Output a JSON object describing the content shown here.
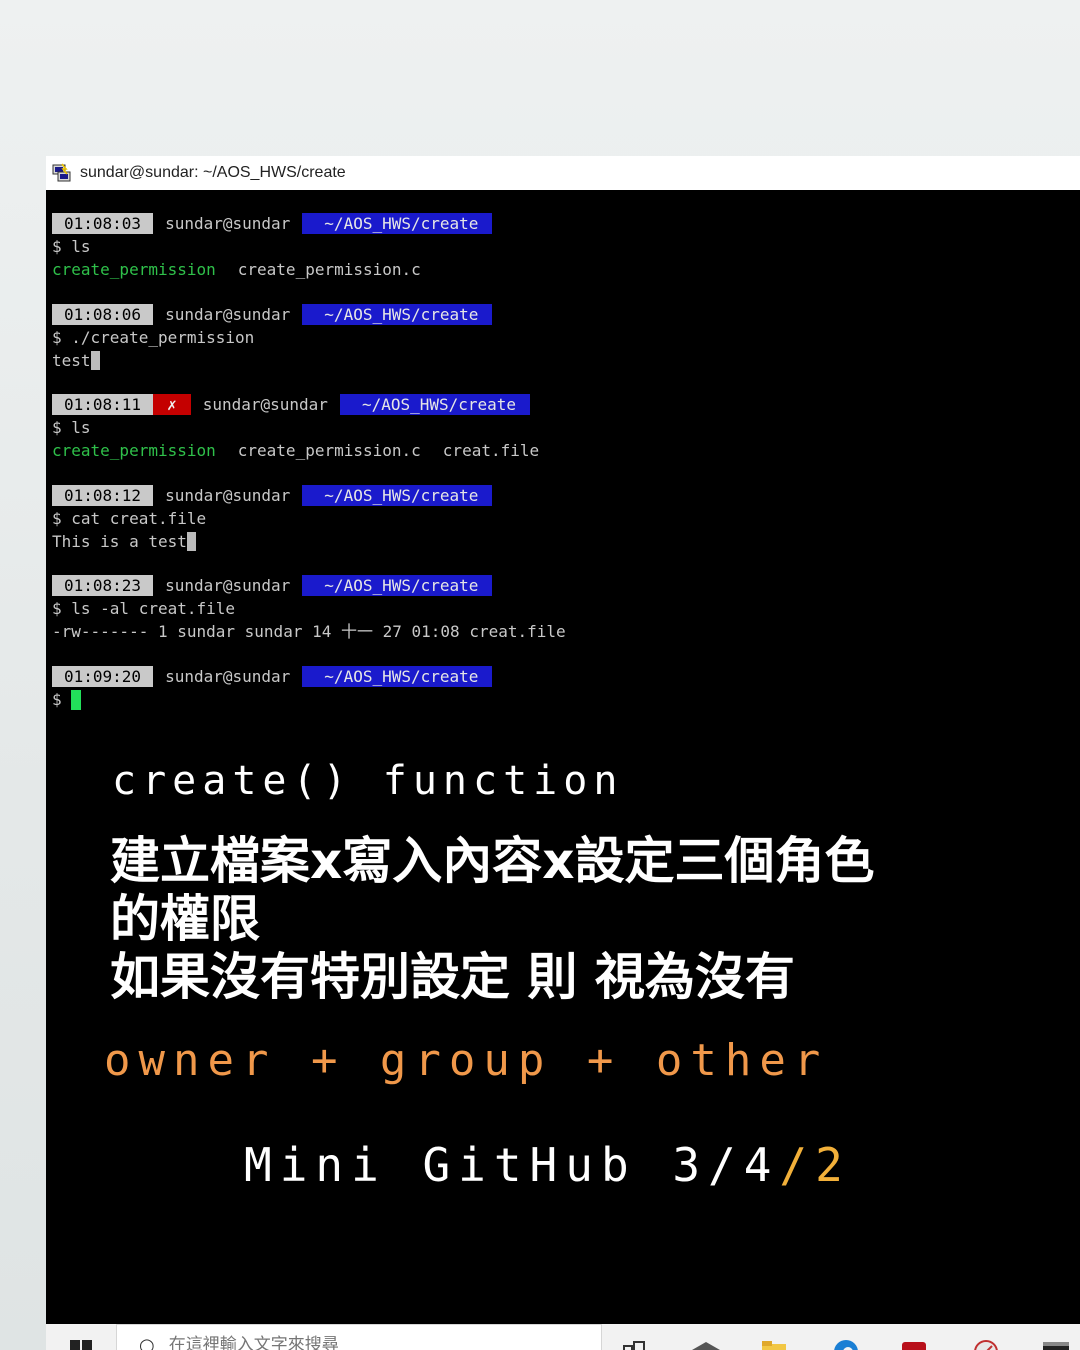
{
  "window": {
    "title": "sundar@sundar: ~/AOS_HWS/create",
    "icon": "putty-icon"
  },
  "terminal": {
    "blocks": [
      {
        "time": "01:08:03",
        "user": "sundar@sundar",
        "path": "~/AOS_HWS/create",
        "command": "$ ls",
        "output": [
          {
            "text": "create_permission",
            "color": "green"
          },
          {
            "text": "create_permission.c",
            "color": "grey"
          }
        ]
      },
      {
        "time": "01:08:06",
        "user": "sundar@sundar",
        "path": "~/AOS_HWS/create",
        "command": "$ ./create_permission",
        "output_text": "test",
        "output_suffix": "%"
      },
      {
        "time": "01:08:11",
        "error": "✗",
        "user": "sundar@sundar",
        "path": "~/AOS_HWS/create",
        "command": "$ ls",
        "output": [
          {
            "text": "create_permission",
            "color": "green"
          },
          {
            "text": "create_permission.c",
            "color": "grey"
          },
          {
            "text": "creat.file",
            "color": "grey"
          }
        ]
      },
      {
        "time": "01:08:12",
        "user": "sundar@sundar",
        "path": "~/AOS_HWS/create",
        "command": "$ cat creat.file",
        "output_text": "This is a test",
        "output_suffix": "%"
      },
      {
        "time": "01:08:23",
        "user": "sundar@sundar",
        "path": "~/AOS_HWS/create",
        "command": "$ ls -al creat.file",
        "output_text": "-rw------- 1 sundar sundar 14 十一 27 01:08 creat.file"
      },
      {
        "time": "01:09:20",
        "user": "sundar@sundar",
        "path": "~/AOS_HWS/create",
        "command": "$"
      }
    ]
  },
  "captions": {
    "function": "create() function",
    "line1": "建立檔案x寫入內容x設定三個角色",
    "line2": "的權限",
    "line3": "如果沒有特別設定 則 視為沒有",
    "roles": "owner + group + other",
    "mini_prefix": "Mini GitHub 3/4",
    "mini_slash": "/",
    "mini_suffix": "2"
  },
  "taskbar": {
    "search_placeholder": "在這裡輸入文字來搜尋",
    "icons": [
      "windows-start-icon",
      "search-icon",
      "task-view-icon",
      "network-icon",
      "file-explorer-icon",
      "edge-icon",
      "app-red-icon",
      "app-pin-icon",
      "terminal-icon"
    ]
  },
  "colors": {
    "time_badge": "#c9c9c9",
    "error_badge": "#c40000",
    "path_badge": "#1a1acc",
    "prompt_green": "#2fc04a",
    "roles_orange": "#f0984a",
    "slash_yellow": "#f2b03a"
  }
}
